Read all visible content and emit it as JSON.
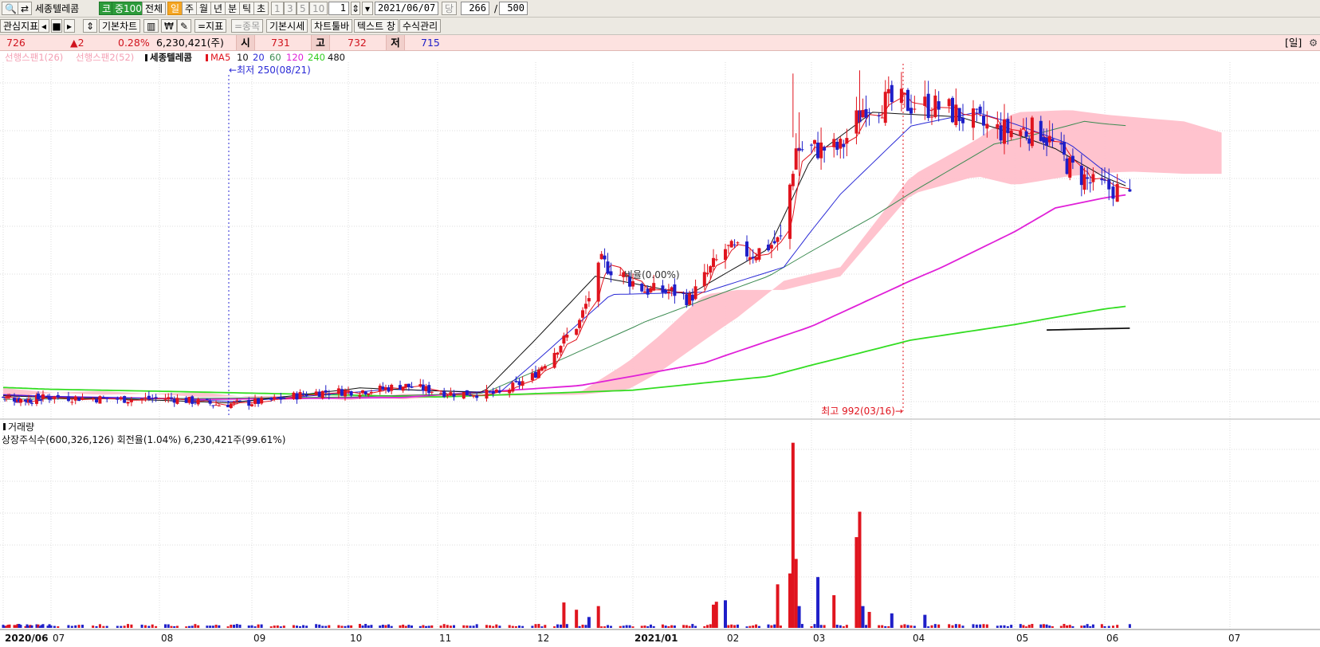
{
  "toolbar": {
    "stock_name": "세종텔레콤",
    "market_badge": "코",
    "index_badge": "중100",
    "period_all": "전체",
    "period_day": "일",
    "period_week": "주",
    "period_month": "월",
    "period_year": "년",
    "period_minute": "분",
    "period_tick": "틱",
    "period_second": "초",
    "interval_1": "1",
    "interval_3": "3",
    "interval_5": "5",
    "interval_10": "10",
    "interval_value": "1",
    "date_value": "2021/06/07",
    "date_suffix": "당",
    "count_current": "266",
    "count_separator": "/",
    "count_total": "500"
  },
  "toolbar2": {
    "interest_label": "관심지표",
    "basic_chart": "기본차트",
    "indicator_button": "=지표",
    "item_button": "=종목",
    "basic_quote": "기본시세",
    "chart_toolbar": "차트툴바",
    "text_window": "텍스트 창",
    "formula_manage": "수식관리"
  },
  "pricebar": {
    "price": "726",
    "change": "▲2",
    "change_pct": "0.28%",
    "volume": "6,230,421(주)",
    "open_label": "시",
    "open": "731",
    "high_label": "고",
    "high": "732",
    "low_label": "저",
    "low": "715",
    "period_tag": "[일]"
  },
  "colors": {
    "up": "#e0141e",
    "down": "#1f1fc8",
    "ma5": "#e0141e",
    "ma10": "#111111",
    "ma20": "#2a2ad6",
    "ma60": "#3a8a50",
    "ma120": "#e020d8",
    "ma240": "#33dd22",
    "ma480": "#111111",
    "cloud": "#ffc0cb"
  },
  "chart_data": {
    "type": "candlestick",
    "legend": {
      "span1": "선행스팬1(26)",
      "span2": "선행스팬2(52)",
      "stock": "세종텔레콤",
      "ma_label": "MA",
      "ma_periods": [
        "5",
        "10",
        "20",
        "60",
        "120",
        "240",
        "480"
      ]
    },
    "annotations": {
      "low_label": "←최저 250(08/21)",
      "high_label": "최고 992(03/16)→",
      "ratio_label": "비율(0.00%)"
    },
    "x_axis": {
      "labels": [
        "2020/06",
        "07",
        "08",
        "09",
        "10",
        "11",
        "12",
        "2021/01",
        "02",
        "03",
        "04",
        "05",
        "06",
        "07"
      ],
      "label_dates": [
        "2020-06-01",
        "2020-07-01",
        "2020-08-01",
        "2020-09-01",
        "2020-10-01",
        "2020-11-01",
        "2020-12-01",
        "2021-01-01",
        "2021-02-01",
        "2021-03-01",
        "2021-04-01",
        "2021-05-01",
        "2021-06-01",
        "2021-07-01"
      ]
    },
    "y_range": [
      230,
      1010
    ],
    "lows": {
      "low_date": "2020-08-21",
      "low_value": 250,
      "high_date": "2021-03-16",
      "high_value": 992
    },
    "price_anchors": [
      [
        "2020-06-01",
        275
      ],
      [
        "2020-06-15",
        268
      ],
      [
        "2020-07-01",
        275
      ],
      [
        "2020-07-20",
        270
      ],
      [
        "2020-08-05",
        272
      ],
      [
        "2020-08-21",
        258
      ],
      [
        "2020-09-05",
        265
      ],
      [
        "2020-09-20",
        285
      ],
      [
        "2020-10-10",
        290
      ],
      [
        "2020-10-20",
        300
      ],
      [
        "2020-11-05",
        283
      ],
      [
        "2020-11-20",
        282
      ],
      [
        "2020-11-30",
        320
      ],
      [
        "2020-12-15",
        440
      ],
      [
        "2020-12-22",
        570
      ],
      [
        "2021-01-05",
        510
      ],
      [
        "2021-01-15",
        505
      ],
      [
        "2021-01-20",
        490
      ],
      [
        "2021-02-01",
        600
      ],
      [
        "2021-02-10",
        590
      ],
      [
        "2021-02-19",
        620
      ],
      [
        "2021-02-24",
        820
      ],
      [
        "2021-03-10",
        820
      ],
      [
        "2021-03-18",
        920
      ],
      [
        "2021-03-30",
        920
      ],
      [
        "2021-04-10",
        910
      ],
      [
        "2021-04-25",
        860
      ],
      [
        "2021-05-10",
        860
      ],
      [
        "2021-05-20",
        780
      ],
      [
        "2021-05-28",
        740
      ],
      [
        "2021-06-07",
        726
      ]
    ],
    "ma_anchors": {
      "ma10": [
        [
          "2020-06-01",
          278
        ],
        [
          "2020-07-15",
          272
        ],
        [
          "2020-08-25",
          262
        ],
        [
          "2020-10-05",
          295
        ],
        [
          "2020-11-15",
          285
        ],
        [
          "2020-12-20",
          540
        ],
        [
          "2021-01-20",
          500
        ],
        [
          "2021-02-15",
          600
        ],
        [
          "2021-03-01",
          800
        ],
        [
          "2021-03-20",
          900
        ],
        [
          "2021-04-15",
          890
        ],
        [
          "2021-05-15",
          820
        ],
        [
          "2021-06-07",
          735
        ]
      ],
      "ma20": [
        [
          "2020-06-01",
          280
        ],
        [
          "2020-07-20",
          274
        ],
        [
          "2020-08-28",
          265
        ],
        [
          "2020-10-15",
          292
        ],
        [
          "2020-11-20",
          285
        ],
        [
          "2020-12-25",
          500
        ],
        [
          "2021-01-25",
          505
        ],
        [
          "2021-02-20",
          560
        ],
        [
          "2021-03-10",
          720
        ],
        [
          "2021-04-01",
          870
        ],
        [
          "2021-04-20",
          900
        ],
        [
          "2021-05-20",
          830
        ],
        [
          "2021-06-07",
          740
        ]
      ],
      "ma60": [
        [
          "2020-06-01",
          270
        ],
        [
          "2020-08-15",
          272
        ],
        [
          "2020-10-01",
          275
        ],
        [
          "2020-11-15",
          283
        ],
        [
          "2021-01-05",
          440
        ],
        [
          "2021-02-15",
          540
        ],
        [
          "2021-03-20",
          670
        ],
        [
          "2021-04-25",
          830
        ],
        [
          "2021-05-25",
          880
        ],
        [
          "2021-06-07",
          870
        ]
      ],
      "ma120": [
        [
          "2020-06-01",
          280
        ],
        [
          "2020-08-15",
          270
        ],
        [
          "2020-10-20",
          274
        ],
        [
          "2020-12-15",
          300
        ],
        [
          "2021-01-25",
          350
        ],
        [
          "2021-03-01",
          430
        ],
        [
          "2021-04-10",
          560
        ],
        [
          "2021-05-15",
          690
        ],
        [
          "2021-06-07",
          720
        ]
      ],
      "ma240": [
        [
          "2020-06-01",
          296
        ],
        [
          "2020-08-21",
          285
        ],
        [
          "2020-11-01",
          275
        ],
        [
          "2021-01-01",
          290
        ],
        [
          "2021-02-15",
          320
        ],
        [
          "2021-04-01",
          400
        ],
        [
          "2021-05-15",
          450
        ],
        [
          "2021-06-07",
          475
        ]
      ],
      "ma480": [
        [
          "2021-05-12",
          422
        ],
        [
          "2021-06-07",
          426
        ]
      ]
    },
    "cloud_anchors": [
      [
        "2020-06-01",
        295,
        275
      ],
      [
        "2020-07-15",
        280,
        288
      ],
      [
        "2020-08-15",
        285,
        275
      ],
      [
        "2020-09-10",
        268,
        278
      ],
      [
        "2020-10-01",
        275,
        268
      ],
      [
        "2020-10-20",
        270,
        282
      ],
      [
        "2020-11-20",
        282,
        278
      ],
      [
        "2020-12-15",
        285,
        280
      ],
      [
        "2020-12-30",
        350,
        290
      ],
      [
        "2021-01-10",
        410,
        330
      ],
      [
        "2021-01-25",
        500,
        400
      ],
      [
        "2021-02-05",
        510,
        450
      ],
      [
        "2021-02-20",
        510,
        530
      ],
      [
        "2021-03-10",
        540,
        560
      ],
      [
        "2021-04-01",
        720,
        760
      ],
      [
        "2021-04-20",
        760,
        840
      ],
      [
        "2021-05-01",
        740,
        900
      ],
      [
        "2021-05-20",
        760,
        905
      ],
      [
        "2021-06-07",
        770,
        890
      ],
      [
        "2021-06-20",
        765,
        880
      ],
      [
        "2021-07-01",
        765,
        850
      ]
    ],
    "volume": {
      "title": "거래량",
      "info": "상장주식수(600,326,126) 회전율(1.04%) 6,230,421주(99.61%)",
      "y_max": 270000000,
      "spikes": [
        [
          "2020-12-10",
          35000000,
          "up"
        ],
        [
          "2020-12-14",
          25000000,
          "up"
        ],
        [
          "2020-12-18",
          15000000,
          "down"
        ],
        [
          "2020-12-21",
          30000000,
          "up"
        ],
        [
          "2021-01-28",
          32000000,
          "up"
        ],
        [
          "2021-01-29",
          36000000,
          "up"
        ],
        [
          "2021-02-01",
          38000000,
          "down"
        ],
        [
          "2021-02-18",
          60000000,
          "up"
        ],
        [
          "2021-02-22",
          75000000,
          "up"
        ],
        [
          "2021-02-23",
          255000000,
          "up"
        ],
        [
          "2021-02-24",
          95000000,
          "up"
        ],
        [
          "2021-02-25",
          30000000,
          "down"
        ],
        [
          "2021-03-03",
          70000000,
          "down"
        ],
        [
          "2021-03-08",
          45000000,
          "up"
        ],
        [
          "2021-03-15",
          125000000,
          "up"
        ],
        [
          "2021-03-16",
          160000000,
          "up"
        ],
        [
          "2021-03-17",
          30000000,
          "down"
        ],
        [
          "2021-03-19",
          22000000,
          "up"
        ],
        [
          "2021-03-26",
          20000000,
          "down"
        ],
        [
          "2021-04-05",
          18000000,
          "down"
        ]
      ]
    }
  }
}
